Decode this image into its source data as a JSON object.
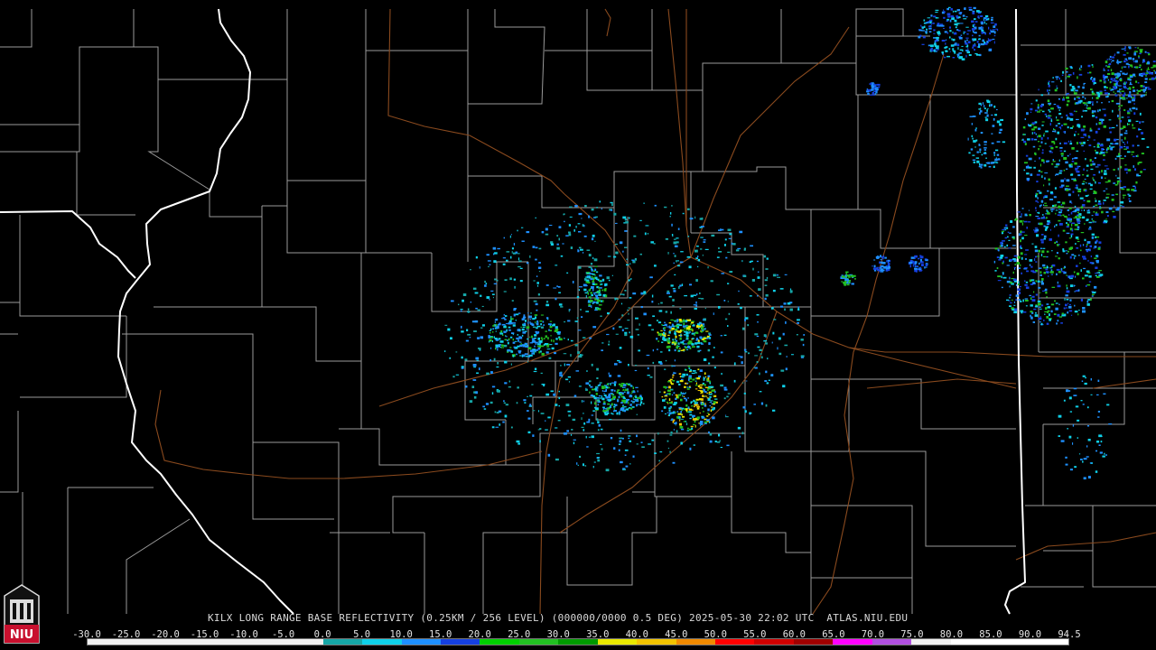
{
  "title": "KILX LONG RANGE BASE REFLECTIVITY (0.25KM / 256 LEVEL) (000000/0000 0.5 DEG) 2025-05-30 22:02 UTC  ATLAS.NIU.EDU",
  "logo_text": "NIU",
  "colors": {
    "background": "#000000",
    "county_lines": "#9a9a9a",
    "state_lines": "#ffffff",
    "roads": "#8a4a1e",
    "logo_red": "#c8102e"
  },
  "scale": {
    "ticks": [
      "-30.0",
      "-25.0",
      "-20.0",
      "-15.0",
      "-10.0",
      "-5.0",
      "0.0",
      "5.0",
      "10.0",
      "15.0",
      "20.0",
      "25.0",
      "30.0",
      "35.0",
      "40.0",
      "45.0",
      "50.0",
      "55.0",
      "60.0",
      "65.0",
      "70.0",
      "75.0",
      "80.0",
      "85.0",
      "90.0",
      "94.5"
    ],
    "colors": [
      "#f2f2f2",
      "#f2f2f2",
      "#f2f2f2",
      "#f2f2f2",
      "#f2f2f2",
      "#f2f2f2",
      "#16a6a6",
      "#0fd0e8",
      "#1e90ff",
      "#1540e0",
      "#00d000",
      "#22c022",
      "#009a00",
      "#e8e800",
      "#f2c400",
      "#f08a00",
      "#ff0000",
      "#d00000",
      "#a00000",
      "#ff00ff",
      "#b050e0",
      "#f0f0f0",
      "#ffffff",
      "#ffffff",
      "#ffffff"
    ]
  }
}
